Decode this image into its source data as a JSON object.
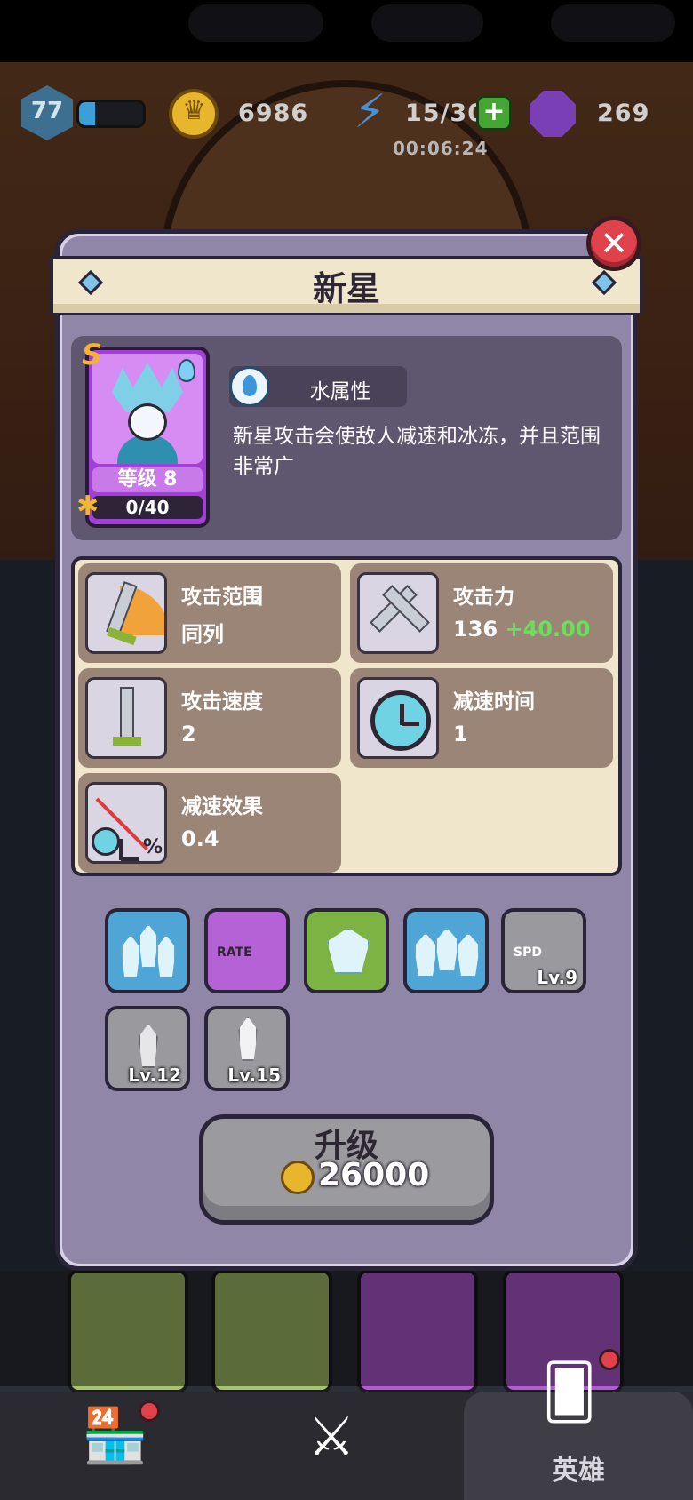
{
  "hud": {
    "player_level": "77",
    "xp_fraction": 0.25,
    "gold": "6986",
    "energy": "15/30",
    "energy_timer": "00:06:24",
    "gems": "269"
  },
  "modal": {
    "title": "新星",
    "close_label": "✕"
  },
  "hero": {
    "rank": "S",
    "level_label": "等级 8",
    "shards": "0/40",
    "attribute": "水属性",
    "description": "新星攻击会使敌人减速和冰冻，并且范围非常广"
  },
  "stats": [
    {
      "name": "attack-range",
      "label": "攻击范围",
      "value": "同列",
      "bonus": ""
    },
    {
      "name": "attack-power",
      "label": "攻击力",
      "value": "136",
      "bonus": "+40.00"
    },
    {
      "name": "attack-speed",
      "label": "攻击速度",
      "value": "2",
      "bonus": ""
    },
    {
      "name": "slow-duration",
      "label": "减速时间",
      "value": "1",
      "bonus": ""
    },
    {
      "name": "slow-effect",
      "label": "减速效果",
      "value": "0.4",
      "bonus": ""
    }
  ],
  "skills": [
    {
      "name": "ice-crystals",
      "color": "#4fa6d6",
      "tag": "",
      "level": ""
    },
    {
      "name": "rate-up",
      "color": "#b462d6",
      "tag": "RATE",
      "level": ""
    },
    {
      "name": "freeze-enemy",
      "color": "#7cb342",
      "tag": "",
      "level": ""
    },
    {
      "name": "triple-crystal",
      "color": "#4fa6d6",
      "tag": "",
      "level": ""
    },
    {
      "name": "speed-up",
      "color": "#9a9a9e",
      "tag": "SPD",
      "level": "Lv.9"
    },
    {
      "name": "crystal-burst",
      "color": "#9a9a9e",
      "tag": "",
      "level": "Lv.12"
    },
    {
      "name": "frost-spikes",
      "color": "#9a9a9e",
      "tag": "",
      "level": "Lv.15"
    }
  ],
  "upgrade": {
    "label": "升级",
    "cost": "26000"
  },
  "nav": {
    "hero_tab": "英雄"
  }
}
